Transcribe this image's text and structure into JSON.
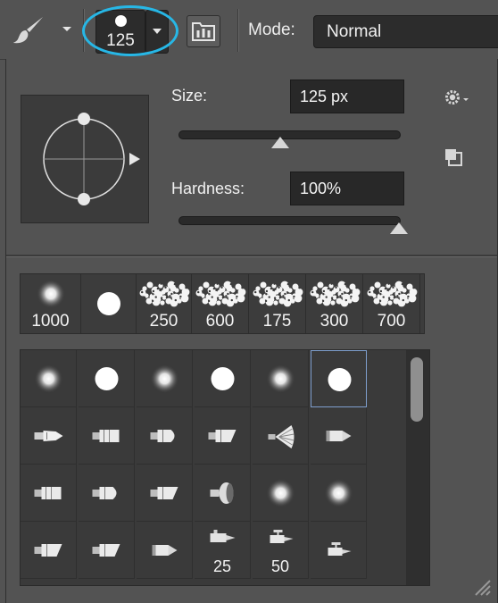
{
  "toolbar": {
    "brush_size_value": "125",
    "mode_label": "Mode:",
    "mode_value": "Normal",
    "icons": [
      "brush-tool-icon",
      "brush-panel-icon",
      "dropdown-arrow-icon"
    ]
  },
  "panel": {
    "size_label": "Size:",
    "size_value": "125 px",
    "size_fraction": 0.46,
    "hardness_label": "Hardness:",
    "hardness_value": "100%",
    "hardness_fraction": 1.0
  },
  "recent_brushes": [
    {
      "type": "soft-round",
      "size": "1000"
    },
    {
      "type": "hard-round",
      "size": ""
    },
    {
      "type": "spatter",
      "size": "250"
    },
    {
      "type": "spatter",
      "size": "600"
    },
    {
      "type": "spatter",
      "size": "175"
    },
    {
      "type": "spatter",
      "size": "300"
    },
    {
      "type": "spatter",
      "size": "700"
    }
  ],
  "preset_grid": [
    [
      {
        "type": "soft-round",
        "size": ""
      },
      {
        "type": "hard-round",
        "size": ""
      },
      {
        "type": "soft-round",
        "size": ""
      },
      {
        "type": "hard-round",
        "size": ""
      },
      {
        "type": "soft-round",
        "size": ""
      },
      {
        "type": "hard-round",
        "size": "",
        "selected": true
      }
    ],
    [
      {
        "type": "brush-tip-pointed",
        "size": ""
      },
      {
        "type": "brush-tip-flat",
        "size": ""
      },
      {
        "type": "brush-tip-round",
        "size": ""
      },
      {
        "type": "brush-tip-angle",
        "size": ""
      },
      {
        "type": "brush-tip-fan",
        "size": ""
      },
      {
        "type": "pencil-tip",
        "size": ""
      }
    ],
    [
      {
        "type": "brush-tip-flat",
        "size": ""
      },
      {
        "type": "brush-tip-round",
        "size": ""
      },
      {
        "type": "brush-tip-angle",
        "size": ""
      },
      {
        "type": "brush-tip-blob",
        "size": ""
      },
      {
        "type": "soft-round",
        "size": ""
      },
      {
        "type": "soft-round",
        "size": ""
      }
    ],
    [
      {
        "type": "brush-tip-angle",
        "size": ""
      },
      {
        "type": "brush-tip-angle",
        "size": ""
      },
      {
        "type": "pencil-tip",
        "size": ""
      },
      {
        "type": "airbrush-tip",
        "size": "25"
      },
      {
        "type": "airbrush-tip-2",
        "size": "50"
      },
      {
        "type": "airbrush-tip-2",
        "size": ""
      }
    ]
  ],
  "colors": {
    "accent_ring": "#27b7e6",
    "selection": "#7f9fce",
    "background": "#535353"
  }
}
